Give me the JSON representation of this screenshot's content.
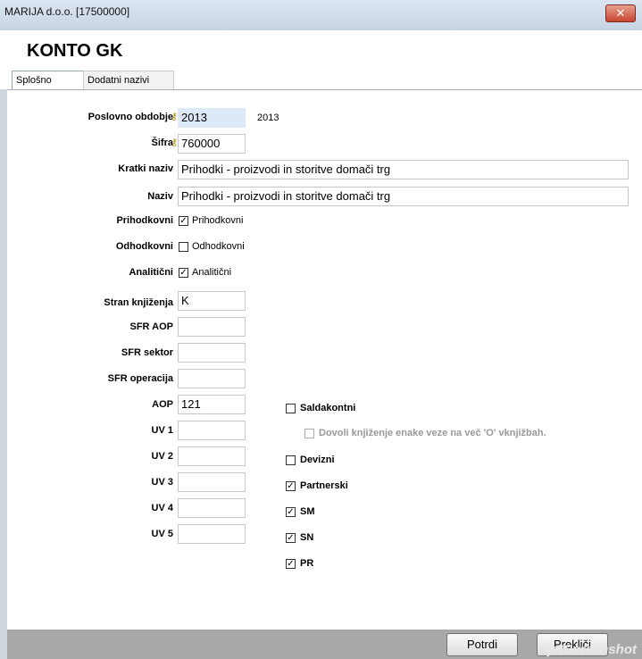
{
  "window": {
    "title": "MARIJA d.o.o. [17500000]",
    "close_label": "✕"
  },
  "header": {
    "heading": "KONTO GK"
  },
  "tabs": [
    {
      "label": "Splošno"
    },
    {
      "label": "Dodatni nazivi"
    }
  ],
  "form": {
    "poslovno_obdobje": {
      "label": "Poslovno obdobje",
      "value": "2013",
      "extra": "2013"
    },
    "sifra": {
      "label": "Šifra",
      "value": "760000"
    },
    "kratki_naziv": {
      "label": "Kratki naziv",
      "value": "Prihodki - proizvodi in storitve domači trg"
    },
    "naziv": {
      "label": "Naziv",
      "value": "Prihodki - proizvodi in storitve domači trg"
    },
    "prihodkovni": {
      "label": "Prihodkovni",
      "cb_label": "Prihodkovni",
      "checked": true
    },
    "odhodkovni": {
      "label": "Odhodkovni",
      "cb_label": "Odhodkovni",
      "checked": false
    },
    "analiticni": {
      "label": "Analitični",
      "cb_label": "Analitični",
      "checked": true
    },
    "stran_knjizenja": {
      "label": "Stran knjiženja",
      "value": "K"
    },
    "sfr_aop": {
      "label": "SFR AOP",
      "value": ""
    },
    "sfr_sektor": {
      "label": "SFR sektor",
      "value": ""
    },
    "sfr_operacija": {
      "label": "SFR operacija",
      "value": ""
    },
    "aop": {
      "label": "AOP",
      "value": "121"
    },
    "uv1": {
      "label": "UV 1",
      "value": ""
    },
    "uv2": {
      "label": "UV 2",
      "value": ""
    },
    "uv3": {
      "label": "UV 3",
      "value": ""
    },
    "uv4": {
      "label": "UV 4",
      "value": ""
    },
    "uv5": {
      "label": "UV 5",
      "value": ""
    }
  },
  "options": {
    "saldakontni": {
      "label": "Saldakontni",
      "checked": false
    },
    "dovoli": {
      "label": "Dovoli knjiženje enake veze na več 'O' vknjižbah.",
      "checked": false
    },
    "devizni": {
      "label": "Devizni",
      "checked": false
    },
    "partnerski": {
      "label": "Partnerski",
      "checked": true
    },
    "sm": {
      "label": "SM",
      "checked": true
    },
    "sn": {
      "label": "SN",
      "checked": true
    },
    "pr": {
      "label": "PR",
      "checked": true
    }
  },
  "buttons": {
    "potrdi": "Potrdi",
    "preklici": "Prekliči"
  },
  "watermark": "jetScreenshot",
  "icons": {
    "key": "key-icon",
    "check": "✓"
  }
}
